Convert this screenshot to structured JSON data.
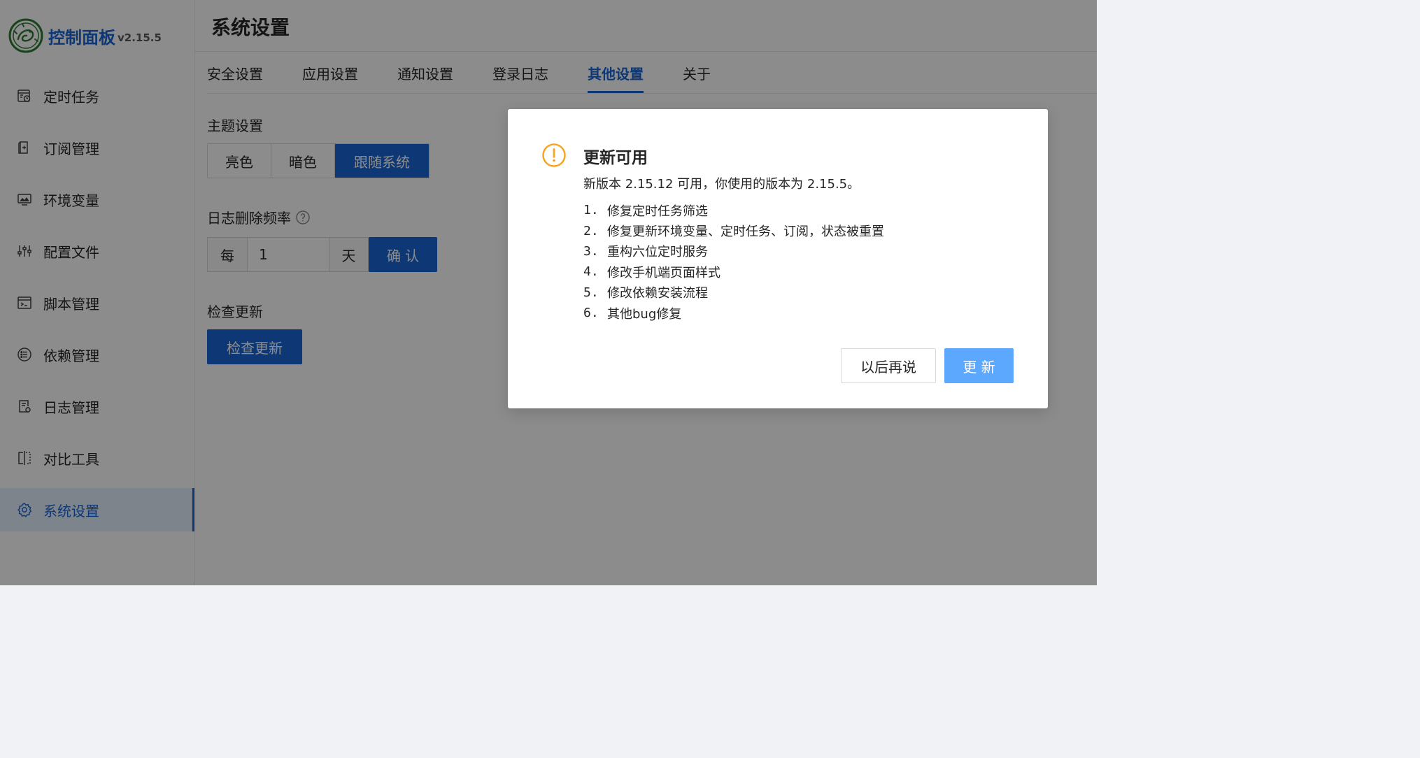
{
  "brand": {
    "title": "控制面板",
    "version": "v2.15.5"
  },
  "sidebar": {
    "items": [
      {
        "label": "定时任务",
        "icon": "calendar-clock-icon"
      },
      {
        "label": "订阅管理",
        "icon": "subscription-icon"
      },
      {
        "label": "环境变量",
        "icon": "monitor-icon"
      },
      {
        "label": "配置文件",
        "icon": "sliders-icon"
      },
      {
        "label": "脚本管理",
        "icon": "terminal-icon"
      },
      {
        "label": "依赖管理",
        "icon": "list-circle-icon"
      },
      {
        "label": "日志管理",
        "icon": "log-file-icon"
      },
      {
        "label": "对比工具",
        "icon": "diff-icon"
      },
      {
        "label": "系统设置",
        "icon": "gear-icon",
        "active": true
      }
    ]
  },
  "page": {
    "title": "系统设置"
  },
  "tabs": [
    {
      "label": "安全设置"
    },
    {
      "label": "应用设置"
    },
    {
      "label": "通知设置"
    },
    {
      "label": "登录日志"
    },
    {
      "label": "其他设置",
      "active": true
    },
    {
      "label": "关于"
    }
  ],
  "settings": {
    "theme": {
      "label": "主题设置",
      "options": [
        "亮色",
        "暗色",
        "跟随系统"
      ],
      "selected": "跟随系统"
    },
    "log_frequency": {
      "label": "日志删除频率",
      "prefix": "每",
      "value": "1",
      "suffix": "天",
      "confirm_label": "确 认"
    },
    "check_update": {
      "label": "检查更新",
      "button_label": "检查更新"
    }
  },
  "modal": {
    "title": "更新可用",
    "description": "新版本 2.15.12 可用，你使用的版本为 2.15.5。",
    "changes": [
      {
        "num": "1.",
        "text": "修复定时任务筛选"
      },
      {
        "num": "2.",
        "text": "修复更新环境变量、定时任务、订阅，状态被重置"
      },
      {
        "num": "3.",
        "text": "重构六位定时服务"
      },
      {
        "num": "4.",
        "text": "修改手机端页面样式"
      },
      {
        "num": "5.",
        "text": "修改依赖安装流程"
      },
      {
        "num": "6.",
        "text": "其他bug修复"
      }
    ],
    "later_label": "以后再说",
    "update_label": "更 新"
  },
  "colors": {
    "primary": "#1a66d6",
    "update_button": "#5ca8ff",
    "warning": "#f5a623",
    "mask": "rgba(0,0,0,0.45)"
  }
}
